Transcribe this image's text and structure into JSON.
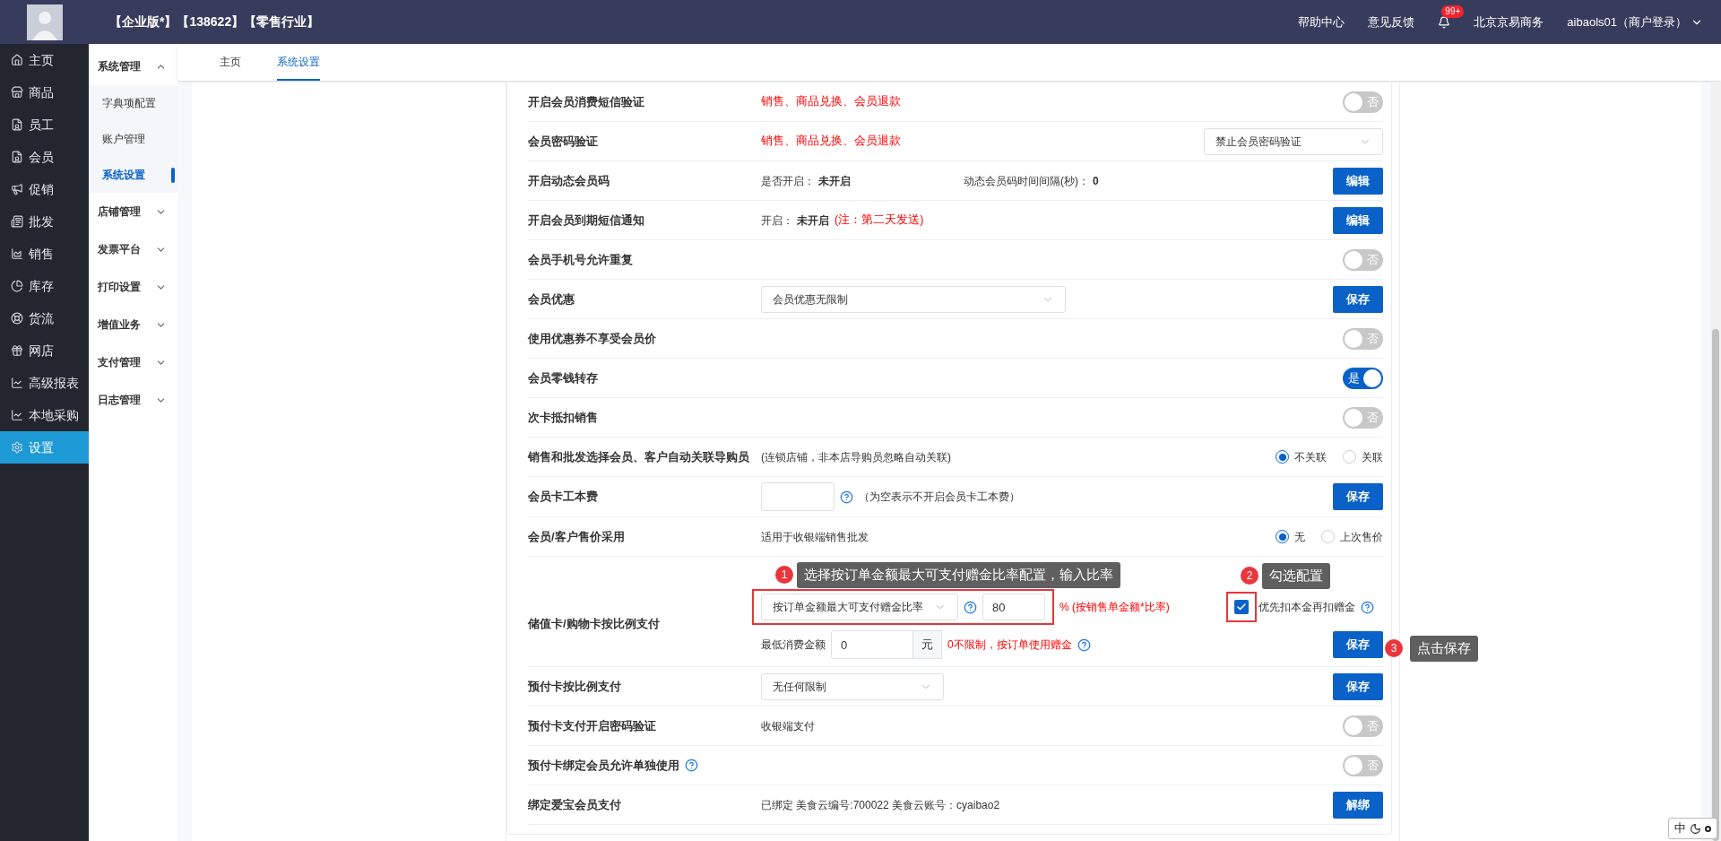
{
  "header": {
    "title": "【企业版*】【138622】【零售行业】",
    "links": [
      "帮助中心",
      "意见反馈"
    ],
    "badge": "99+",
    "company": "北京京易商务",
    "user": "aibaols01（商户登录）"
  },
  "nav": [
    {
      "label": "主页",
      "selected": false
    },
    {
      "label": "商品",
      "selected": false
    },
    {
      "label": "员工",
      "selected": false
    },
    {
      "label": "会员",
      "selected": false
    },
    {
      "label": "促销",
      "selected": false
    },
    {
      "label": "批发",
      "selected": false
    },
    {
      "label": "销售",
      "selected": false
    },
    {
      "label": "库存",
      "selected": false
    },
    {
      "label": "货流",
      "selected": false
    },
    {
      "label": "网店",
      "selected": false
    },
    {
      "label": "高级报表",
      "selected": false
    },
    {
      "label": "本地采购",
      "selected": false
    },
    {
      "label": "设置",
      "selected": true
    }
  ],
  "submenu": [
    {
      "label": "系统管理",
      "expanded": true,
      "children": [
        {
          "label": "字典项配置",
          "selected": false
        },
        {
          "label": "账户管理",
          "selected": false
        },
        {
          "label": "系统设置",
          "selected": true
        }
      ]
    },
    {
      "label": "店铺管理",
      "expanded": false
    },
    {
      "label": "发票平台",
      "expanded": false
    },
    {
      "label": "打印设置",
      "expanded": false
    },
    {
      "label": "增值业务",
      "expanded": false
    },
    {
      "label": "支付管理",
      "expanded": false
    },
    {
      "label": "日志管理",
      "expanded": false
    }
  ],
  "tabs": [
    {
      "label": "主页",
      "selected": false
    },
    {
      "label": "系统设置",
      "selected": true
    }
  ],
  "rows": [
    {
      "kind": "setting",
      "label": "开启会员消费短信验证",
      "middle": [
        {
          "kind": "red",
          "text": "销售、商品兑换、会员退款"
        }
      ],
      "control": {
        "kind": "toggle",
        "on": false,
        "label": "否"
      }
    },
    {
      "kind": "setting",
      "label": "会员密码验证",
      "middle": [
        {
          "kind": "red",
          "text": "销售、商品兑换、会员退款"
        }
      ],
      "control": {
        "kind": "select",
        "value": "禁止会员密码验证"
      }
    },
    {
      "kind": "setting",
      "label": "开启动态会员码",
      "middle": [
        {
          "kind": "pair",
          "label": "是否开启：",
          "value": "未开启"
        },
        {
          "kind": "pair",
          "label": "动态会员码时间间隔(秒)：",
          "value": "0"
        }
      ],
      "control": {
        "kind": "button",
        "label": "编辑"
      }
    },
    {
      "kind": "setting",
      "label": "开启会员到期短信通知",
      "middle": [
        {
          "kind": "pair",
          "label": "开启：",
          "value": "未开启"
        },
        {
          "kind": "red",
          "text": "(注：第二天发送)"
        }
      ],
      "control": {
        "kind": "button",
        "label": "编辑"
      }
    },
    {
      "kind": "setting",
      "label": "会员手机号允许重复",
      "control": {
        "kind": "toggle",
        "on": false,
        "label": "否"
      }
    },
    {
      "kind": "setting",
      "label": "会员优惠",
      "middle": [
        {
          "kind": "select",
          "value": "会员优惠无限制"
        }
      ],
      "control": {
        "kind": "button",
        "label": "保存"
      }
    },
    {
      "kind": "setting",
      "label": "使用优惠券不享受会员价",
      "control": {
        "kind": "toggle",
        "on": false,
        "label": "否"
      }
    },
    {
      "kind": "setting",
      "label": "会员零钱转存",
      "control": {
        "kind": "toggle",
        "on": true,
        "label": "是"
      }
    },
    {
      "kind": "setting",
      "label": "次卡抵扣销售",
      "control": {
        "kind": "toggle",
        "on": false,
        "label": "否"
      }
    },
    {
      "kind": "setting",
      "label": "销售和批发选择会员、客户自动关联导购员",
      "middle": [
        {
          "kind": "note",
          "text": "(连锁店铺，非本店导购员忽略自动关联)"
        }
      ],
      "control": {
        "kind": "radios",
        "options": [
          {
            "label": "不关联",
            "selected": true
          },
          {
            "label": "关联",
            "selected": false
          }
        ]
      }
    },
    {
      "kind": "setting",
      "label": "会员卡工本费",
      "middle": [
        {
          "kind": "input"
        },
        {
          "kind": "help"
        },
        {
          "kind": "note",
          "text": "（为空表示不开启会员卡工本费）"
        }
      ],
      "control": {
        "kind": "button",
        "label": "保存"
      }
    },
    {
      "kind": "setting",
      "label": "会员/客户售价采用",
      "middle": [
        {
          "kind": "note",
          "text": "适用于收银端销售批发"
        }
      ],
      "control": {
        "kind": "radios",
        "options": [
          {
            "label": "无",
            "selected": true
          },
          {
            "label": "上次售价",
            "selected": false
          }
        ]
      }
    },
    {
      "kind": "ratio",
      "label": "储值卡/购物卡按比例支付",
      "select": "按订单金额最大可支付赠金比率",
      "ratio": "80",
      "ratio_note": "% (按销售单金额*比率)",
      "checkbox": {
        "label": "优先扣本金再扣赠金",
        "checked": true
      },
      "min_label": "最低消费金额",
      "min_value": "0",
      "unit": "元",
      "min_note": "0不限制，按订单使用赠金",
      "button": "保存"
    },
    {
      "kind": "setting",
      "label": "预付卡按比例支付",
      "middle": [
        {
          "kind": "select",
          "value": "无任何限制"
        }
      ],
      "control": {
        "kind": "button",
        "label": "保存"
      }
    },
    {
      "kind": "setting",
      "label": "预付卡支付开启密码验证",
      "middle": [
        {
          "kind": "note",
          "text": "收银端支付"
        }
      ],
      "control": {
        "kind": "toggle",
        "on": false,
        "label": "否"
      }
    },
    {
      "kind": "setting",
      "label": "预付卡绑定会员允许单独使用",
      "label_help": true,
      "control": {
        "kind": "toggle",
        "on": false,
        "label": "否"
      }
    },
    {
      "kind": "setting",
      "label": "绑定爱宝会员支付",
      "middle": [
        {
          "kind": "note",
          "text": "已绑定 美食云编号:700022 美食云账号：cyaibao2"
        }
      ],
      "control": {
        "kind": "button",
        "label": "解绑"
      }
    }
  ],
  "annotations": [
    {
      "number": "1",
      "text": "选择按订单金额最大可支付赠金比率配置，输入比率"
    },
    {
      "number": "2",
      "text": "勾选配置"
    },
    {
      "number": "3",
      "text": "点击保存"
    }
  ],
  "ime": {
    "label": "中"
  }
}
